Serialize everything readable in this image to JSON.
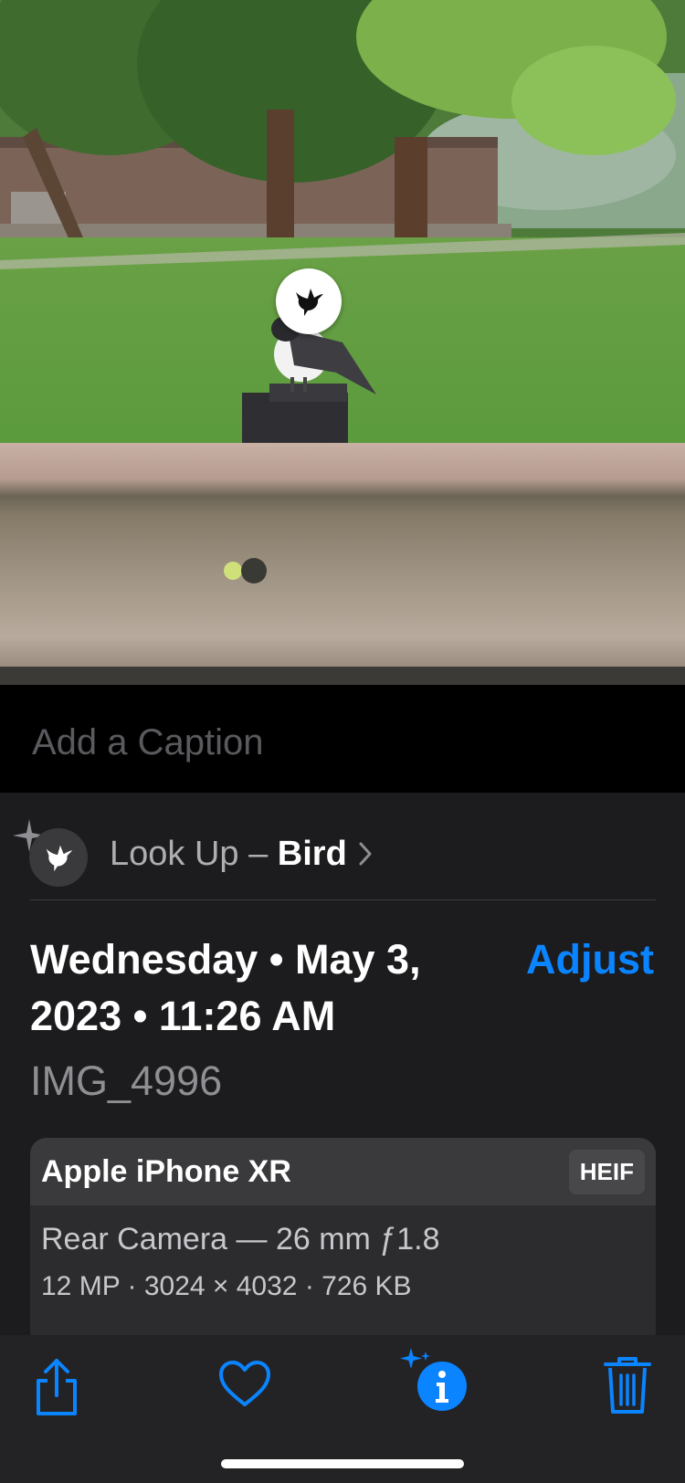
{
  "photo": {
    "visual_lookup_badge": "bird-icon"
  },
  "caption": {
    "placeholder": "Add a Caption"
  },
  "lookup": {
    "prefix": "Look Up – ",
    "subject": "Bird"
  },
  "datetime": {
    "text": "Wednesday • May 3, 2023 • 11:26 AM"
  },
  "adjust_label": "Adjust",
  "filename": "IMG_4996",
  "camera": {
    "device": "Apple iPhone XR",
    "format": "HEIF",
    "lens": "Rear Camera — 26 mm ƒ1.8",
    "specs": "12 MP  ·  3024 × 4032  ·  726 KB"
  },
  "toolbar": {
    "items": [
      "share-icon",
      "heart-icon",
      "info-sparkle-icon",
      "trash-icon"
    ]
  },
  "colors": {
    "accent": "#0a84ff",
    "panel": "#1c1c1e",
    "caption_bg": "#000000"
  }
}
